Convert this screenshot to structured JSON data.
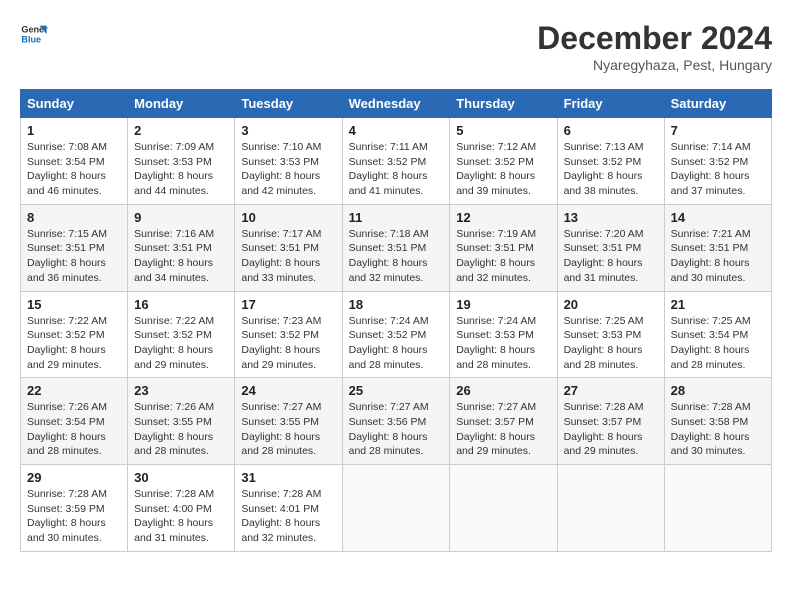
{
  "header": {
    "logo_line1": "General",
    "logo_line2": "Blue",
    "month": "December 2024",
    "location": "Nyaregyhaza, Pest, Hungary"
  },
  "weekdays": [
    "Sunday",
    "Monday",
    "Tuesday",
    "Wednesday",
    "Thursday",
    "Friday",
    "Saturday"
  ],
  "weeks": [
    [
      {
        "day": "1",
        "info": "Sunrise: 7:08 AM\nSunset: 3:54 PM\nDaylight: 8 hours\nand 46 minutes."
      },
      {
        "day": "2",
        "info": "Sunrise: 7:09 AM\nSunset: 3:53 PM\nDaylight: 8 hours\nand 44 minutes."
      },
      {
        "day": "3",
        "info": "Sunrise: 7:10 AM\nSunset: 3:53 PM\nDaylight: 8 hours\nand 42 minutes."
      },
      {
        "day": "4",
        "info": "Sunrise: 7:11 AM\nSunset: 3:52 PM\nDaylight: 8 hours\nand 41 minutes."
      },
      {
        "day": "5",
        "info": "Sunrise: 7:12 AM\nSunset: 3:52 PM\nDaylight: 8 hours\nand 39 minutes."
      },
      {
        "day": "6",
        "info": "Sunrise: 7:13 AM\nSunset: 3:52 PM\nDaylight: 8 hours\nand 38 minutes."
      },
      {
        "day": "7",
        "info": "Sunrise: 7:14 AM\nSunset: 3:52 PM\nDaylight: 8 hours\nand 37 minutes."
      }
    ],
    [
      {
        "day": "8",
        "info": "Sunrise: 7:15 AM\nSunset: 3:51 PM\nDaylight: 8 hours\nand 36 minutes."
      },
      {
        "day": "9",
        "info": "Sunrise: 7:16 AM\nSunset: 3:51 PM\nDaylight: 8 hours\nand 34 minutes."
      },
      {
        "day": "10",
        "info": "Sunrise: 7:17 AM\nSunset: 3:51 PM\nDaylight: 8 hours\nand 33 minutes."
      },
      {
        "day": "11",
        "info": "Sunrise: 7:18 AM\nSunset: 3:51 PM\nDaylight: 8 hours\nand 32 minutes."
      },
      {
        "day": "12",
        "info": "Sunrise: 7:19 AM\nSunset: 3:51 PM\nDaylight: 8 hours\nand 32 minutes."
      },
      {
        "day": "13",
        "info": "Sunrise: 7:20 AM\nSunset: 3:51 PM\nDaylight: 8 hours\nand 31 minutes."
      },
      {
        "day": "14",
        "info": "Sunrise: 7:21 AM\nSunset: 3:51 PM\nDaylight: 8 hours\nand 30 minutes."
      }
    ],
    [
      {
        "day": "15",
        "info": "Sunrise: 7:22 AM\nSunset: 3:52 PM\nDaylight: 8 hours\nand 29 minutes."
      },
      {
        "day": "16",
        "info": "Sunrise: 7:22 AM\nSunset: 3:52 PM\nDaylight: 8 hours\nand 29 minutes."
      },
      {
        "day": "17",
        "info": "Sunrise: 7:23 AM\nSunset: 3:52 PM\nDaylight: 8 hours\nand 29 minutes."
      },
      {
        "day": "18",
        "info": "Sunrise: 7:24 AM\nSunset: 3:52 PM\nDaylight: 8 hours\nand 28 minutes."
      },
      {
        "day": "19",
        "info": "Sunrise: 7:24 AM\nSunset: 3:53 PM\nDaylight: 8 hours\nand 28 minutes."
      },
      {
        "day": "20",
        "info": "Sunrise: 7:25 AM\nSunset: 3:53 PM\nDaylight: 8 hours\nand 28 minutes."
      },
      {
        "day": "21",
        "info": "Sunrise: 7:25 AM\nSunset: 3:54 PM\nDaylight: 8 hours\nand 28 minutes."
      }
    ],
    [
      {
        "day": "22",
        "info": "Sunrise: 7:26 AM\nSunset: 3:54 PM\nDaylight: 8 hours\nand 28 minutes."
      },
      {
        "day": "23",
        "info": "Sunrise: 7:26 AM\nSunset: 3:55 PM\nDaylight: 8 hours\nand 28 minutes."
      },
      {
        "day": "24",
        "info": "Sunrise: 7:27 AM\nSunset: 3:55 PM\nDaylight: 8 hours\nand 28 minutes."
      },
      {
        "day": "25",
        "info": "Sunrise: 7:27 AM\nSunset: 3:56 PM\nDaylight: 8 hours\nand 28 minutes."
      },
      {
        "day": "26",
        "info": "Sunrise: 7:27 AM\nSunset: 3:57 PM\nDaylight: 8 hours\nand 29 minutes."
      },
      {
        "day": "27",
        "info": "Sunrise: 7:28 AM\nSunset: 3:57 PM\nDaylight: 8 hours\nand 29 minutes."
      },
      {
        "day": "28",
        "info": "Sunrise: 7:28 AM\nSunset: 3:58 PM\nDaylight: 8 hours\nand 30 minutes."
      }
    ],
    [
      {
        "day": "29",
        "info": "Sunrise: 7:28 AM\nSunset: 3:59 PM\nDaylight: 8 hours\nand 30 minutes."
      },
      {
        "day": "30",
        "info": "Sunrise: 7:28 AM\nSunset: 4:00 PM\nDaylight: 8 hours\nand 31 minutes."
      },
      {
        "day": "31",
        "info": "Sunrise: 7:28 AM\nSunset: 4:01 PM\nDaylight: 8 hours\nand 32 minutes."
      },
      null,
      null,
      null,
      null
    ]
  ]
}
